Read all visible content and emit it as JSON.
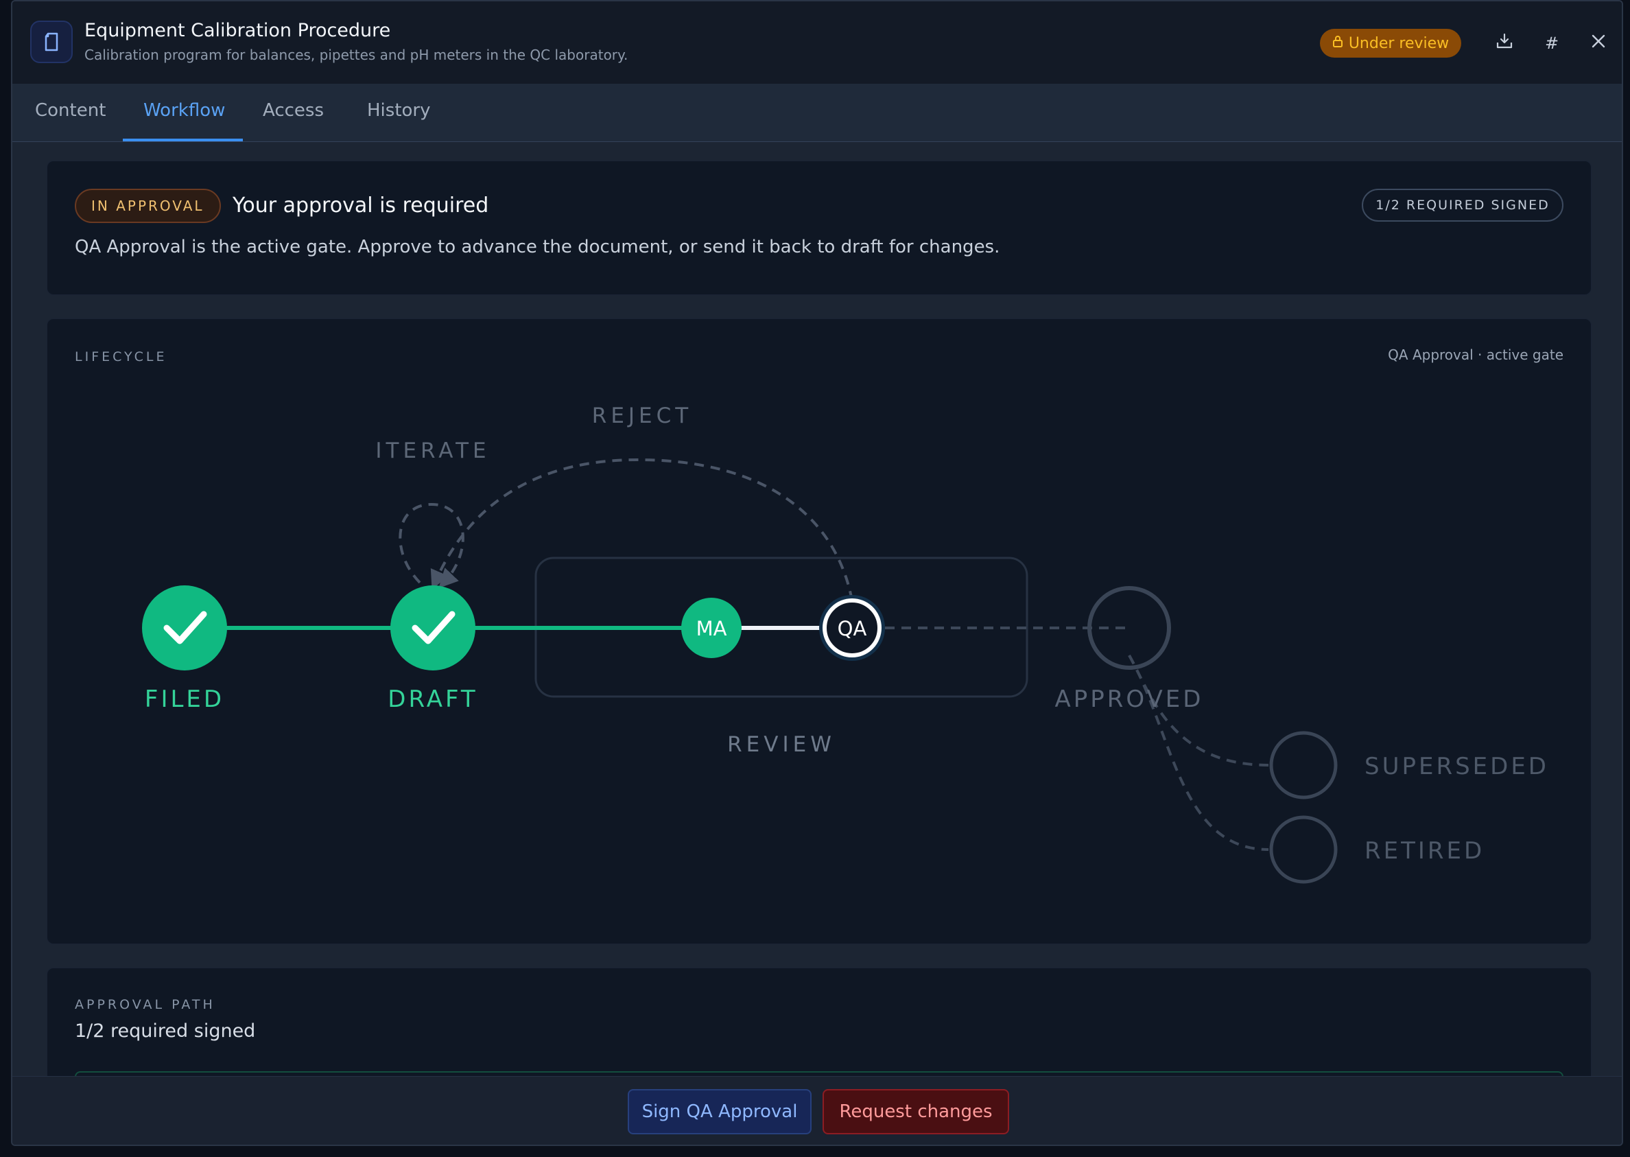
{
  "header": {
    "title": "Equipment Calibration Procedure",
    "subtitle": "Calibration program for balances, pipettes and pH meters in the QC laboratory.",
    "status_badge": "Under review",
    "icons": [
      "document-icon",
      "lock-icon",
      "download-icon",
      "hash-icon",
      "close-icon"
    ],
    "hash_symbol": "#"
  },
  "tabs": [
    {
      "label": "Content"
    },
    {
      "label": "Workflow",
      "active": true
    },
    {
      "label": "Access"
    },
    {
      "label": "History"
    }
  ],
  "approval": {
    "state_pill": "IN APPROVAL",
    "title": "Your approval is required",
    "description": "QA Approval is the active gate. Approve to advance the document, or send it back to draft for changes.",
    "signed_pill": "1/2 REQUIRED SIGNED"
  },
  "lifecycle": {
    "section_label": "LIFECYCLE",
    "active_gate": "QA Approval · active gate",
    "labels": {
      "filed": "FILED",
      "draft": "DRAFT",
      "review": "REVIEW",
      "approved": "APPROVED",
      "superseded": "SUPERSEDED",
      "retired": "RETIRED",
      "iterate": "ITERATE",
      "reject": "REJECT"
    },
    "gates": {
      "ma": "MA",
      "qa": "QA"
    }
  },
  "approval_path": {
    "section_label": "APPROVAL PATH",
    "summary": "1/2 required signed"
  },
  "footer": {
    "sign_button": "Sign QA Approval",
    "request_button": "Request changes"
  },
  "colors": {
    "accent": "#3b8ff0",
    "complete": "#10b981",
    "warning": "#fbbf24",
    "danger": "#8c1d23"
  }
}
